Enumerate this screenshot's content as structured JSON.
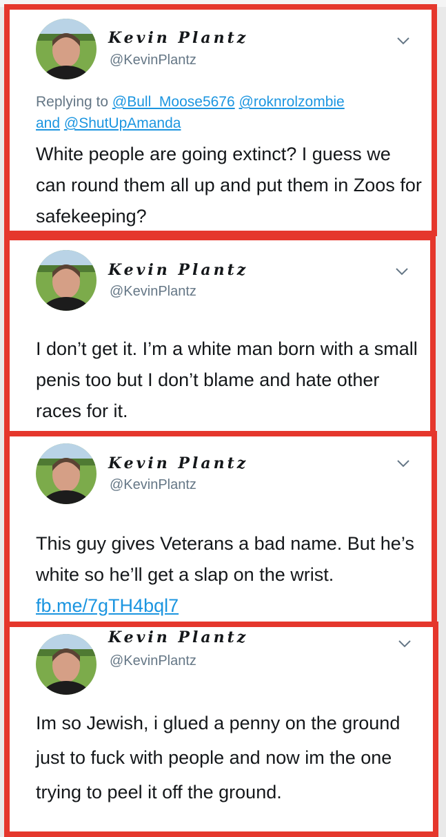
{
  "tweets": [
    {
      "name": "Kevin Plantz",
      "handle": "@KevinPlantz",
      "reply_prefix": "Replying to",
      "reply_mentions": [
        "@Bull_Moose5676",
        "@roknrolzombie",
        "@ShutUpAmanda"
      ],
      "reply_joiner": "and",
      "text": "White people are going extinct? I guess we can round them all up and put them in Zoos for safekeeping?"
    },
    {
      "name": "Kevin Plantz",
      "handle": "@KevinPlantz",
      "text": "I don’t get it. I’m a white man born with a small penis too but I don’t blame and hate other races for it."
    },
    {
      "name": "Kevin Plantz",
      "handle": "@KevinPlantz",
      "text": "This guy gives Veterans a bad name. But he’s white so he’ll get a slap on the wrist.",
      "link": "fb.me/7gTH4bql7"
    },
    {
      "name": "Kevin Plantz",
      "handle": "@KevinPlantz",
      "text": "Im so Jewish, i glued a penny on the ground just to fuck with people and now im the one trying to peel it off the ground."
    }
  ],
  "colors": {
    "border": "#e5372c",
    "link": "#1b95e0",
    "handle": "#657786",
    "text": "#14171a"
  },
  "icons": {
    "more": "chevron-down-icon",
    "avatar": "avatar"
  }
}
